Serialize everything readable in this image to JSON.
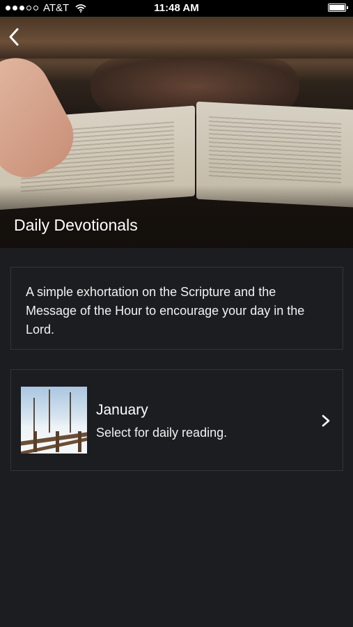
{
  "status_bar": {
    "carrier": "AT&T",
    "time": "11:48 AM",
    "signal_dots_filled": 3,
    "signal_dots_total": 5
  },
  "header": {
    "title": "Daily Devotionals",
    "back_icon": "chevron-left-icon"
  },
  "description": {
    "text": "A simple exhortation on the Scripture and the Message of the Hour to encourage your day in the Lord."
  },
  "months": [
    {
      "title": "January",
      "subtitle": "Select for daily reading.",
      "icon": "chevron-right-icon"
    }
  ],
  "colors": {
    "background": "#1c1d21",
    "card_border": "#32343a",
    "text": "#ffffff"
  }
}
